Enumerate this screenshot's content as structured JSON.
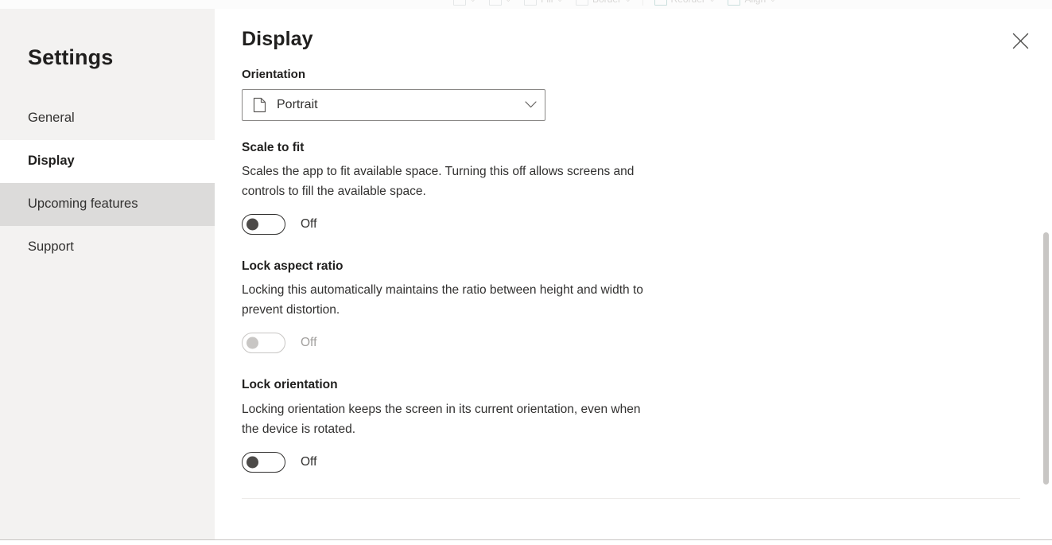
{
  "background_toolbar": {
    "items": [
      {
        "label": "",
        "icon": "arc-icon",
        "chevron": "⌄"
      },
      {
        "label": "",
        "icon": "lines-icon",
        "chevron": "⌄"
      },
      {
        "label": "Fill",
        "icon": "fill-icon",
        "chevron": "⌄"
      },
      {
        "label": "Border",
        "icon": "border-icon",
        "chevron": "⌄"
      },
      {
        "label": "Reorder",
        "icon": "reorder-icon",
        "chevron": "⌄"
      },
      {
        "label": "Align",
        "icon": "align-icon",
        "chevron": "⌄"
      }
    ]
  },
  "sidebar": {
    "title": "Settings",
    "items": [
      {
        "label": "General",
        "state": "normal"
      },
      {
        "label": "Display",
        "state": "selected"
      },
      {
        "label": "Upcoming features",
        "state": "hovered"
      },
      {
        "label": "Support",
        "state": "normal"
      }
    ]
  },
  "main": {
    "title": "Display",
    "close_label": "Close",
    "orientation": {
      "label": "Orientation",
      "value": "Portrait",
      "icon": "page-portrait-icon",
      "chevron_icon": "chevron-down-icon"
    },
    "settings": [
      {
        "title": "Scale to fit",
        "description": "Scales the app to fit available space. Turning this off allows screens and controls to fill the available space.",
        "toggle_state": "Off",
        "disabled": false
      },
      {
        "title": "Lock aspect ratio",
        "description": "Locking this automatically maintains the ratio between height and width to prevent distortion.",
        "toggle_state": "Off",
        "disabled": true
      },
      {
        "title": "Lock orientation",
        "description": "Locking orientation keeps the screen in its current orientation, even when the device is rotated.",
        "toggle_state": "Off",
        "disabled": false
      }
    ]
  },
  "colors": {
    "sidebar_bg": "#f3f2f1",
    "selected_bg": "#ffffff",
    "hover_bg": "#dcdbda",
    "text_primary": "#201f1e",
    "text_secondary": "#323130",
    "text_disabled": "#a19f9d",
    "border": "#8a8886",
    "divider": "#edebe9",
    "scrollbar": "#c8c6c4"
  }
}
